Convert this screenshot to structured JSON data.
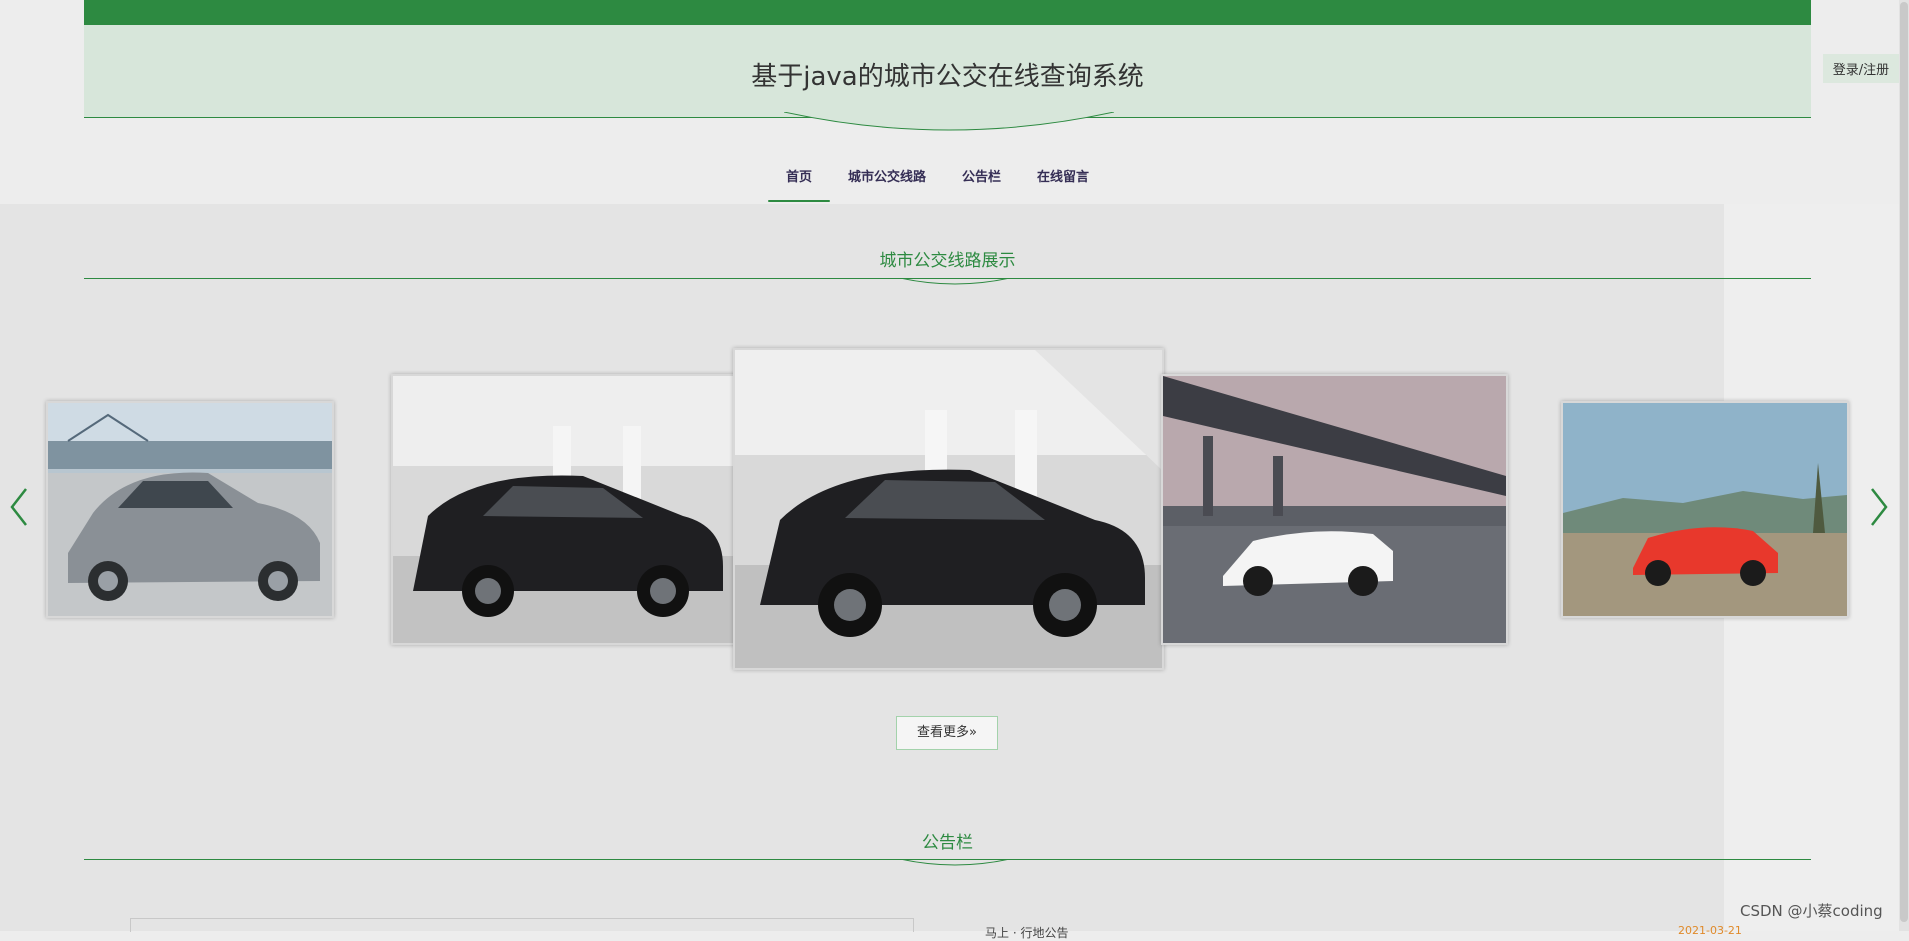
{
  "header": {
    "site_title": "基于java的城市公交在线查询系统",
    "login_label": "登录/注册"
  },
  "nav": {
    "items": [
      {
        "label": "首页",
        "active": true
      },
      {
        "label": "城市公交线路",
        "active": false
      },
      {
        "label": "公告栏",
        "active": false
      },
      {
        "label": "在线留言",
        "active": false
      }
    ]
  },
  "routes_section": {
    "title": "城市公交线路展示",
    "more_label": "查看更多",
    "more_icon": "double-chevron-right-icon",
    "cards": [
      {
        "subject": "silver sedan"
      },
      {
        "subject": "black suv showroom"
      },
      {
        "subject": "black suv showroom"
      },
      {
        "subject": "white sports car under bridge"
      },
      {
        "subject": "red sports car"
      }
    ]
  },
  "notice_section": {
    "title": "公告栏",
    "first_item": "马上 · 行地公告",
    "first_date": "2021-03-21"
  },
  "watermark": "CSDN @小蔡coding",
  "colors": {
    "accent": "#2d8a41",
    "header_band": "#d7e6da",
    "nav_text": "#352e55",
    "date": "#e08a2a"
  }
}
